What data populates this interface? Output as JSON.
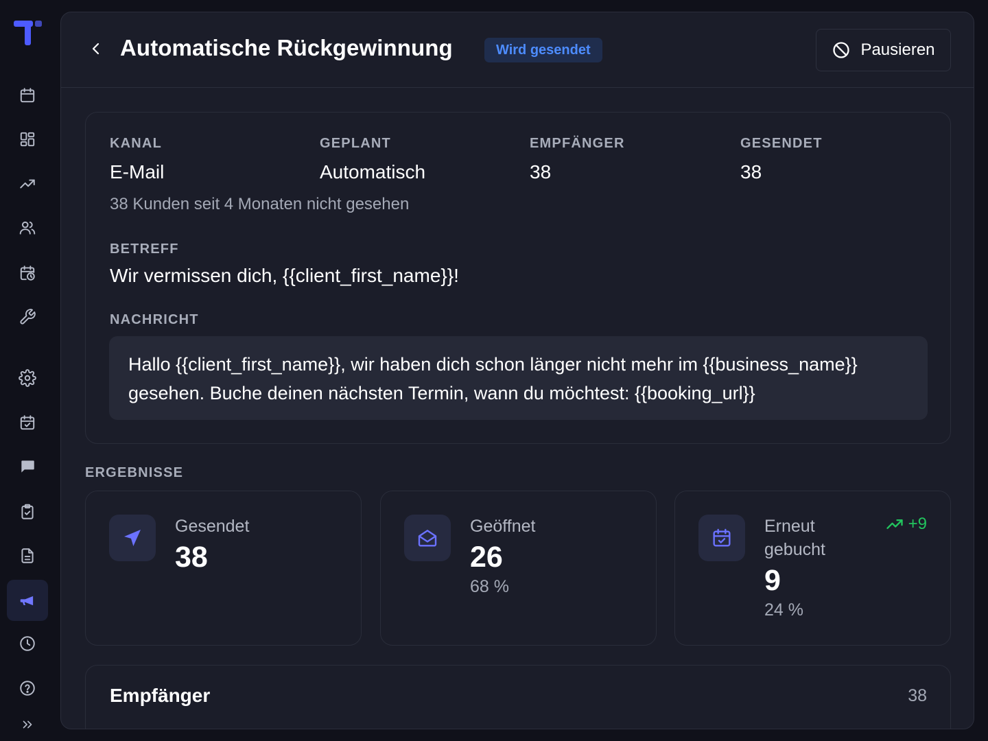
{
  "header": {
    "title": "Automatische Rückgewinnung",
    "status_badge": "Wird gesendet",
    "pause_label": "Pausieren"
  },
  "details": {
    "channel_label": "KANAL",
    "channel_value": "E-Mail",
    "scheduled_label": "GEPLANT",
    "scheduled_value": "Automatisch",
    "recipients_label": "EMPFÄNGER",
    "recipients_value": "38",
    "sent_label": "GESENDET",
    "sent_value": "38",
    "audience_note": "38 Kunden seit 4 Monaten nicht gesehen",
    "subject_label": "BETREFF",
    "subject_value": "Wir vermissen dich, {{client_first_name}}!",
    "message_label": "NACHRICHT",
    "message_value": "Hallo {{client_first_name}}, wir haben dich schon länger nicht mehr im {{business_name}} gesehen. Buche deinen nächsten Termin, wann du möchtest: {{booking_url}}"
  },
  "results": {
    "label": "ERGEBNISSE",
    "sent": {
      "label": "Gesendet",
      "value": "38"
    },
    "opened": {
      "label": "Geöffnet",
      "value": "26",
      "sub": "68 %"
    },
    "rebooked": {
      "label": "Erneut gebucht",
      "value": "9",
      "sub": "24 %",
      "trend": "+9"
    }
  },
  "recipients": {
    "title": "Empfänger",
    "count": "38"
  },
  "sidebar": {
    "items": [
      "calendar-icon",
      "dashboard-icon",
      "trending-up-icon",
      "users-icon",
      "calendar-clock-icon",
      "wrench-icon",
      "settings-icon",
      "calendar-check-icon",
      "chat-icon",
      "clipboard-check-icon",
      "document-icon",
      "megaphone-icon",
      "clock-icon",
      "help-icon",
      "expand-icon"
    ],
    "active": "megaphone-icon"
  },
  "colors": {
    "accent": "#6b72ff",
    "badge_text": "#4d8cff",
    "badge_bg": "#1f2d4d",
    "positive": "#22c55e",
    "panel_bg": "#1b1d29",
    "page_bg": "#10111a"
  }
}
